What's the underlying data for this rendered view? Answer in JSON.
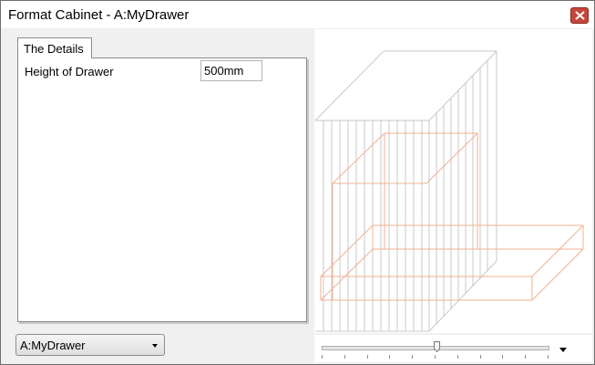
{
  "window": {
    "title": "Format Cabinet - A:MyDrawer"
  },
  "tabs": [
    {
      "label": "The Details"
    }
  ],
  "details": {
    "height_label": "Height of Drawer",
    "height_value": "500mm"
  },
  "object_selector": {
    "selected": "A:MyDrawer"
  },
  "zoom_slider": {
    "level": 0.51
  },
  "colors": {
    "cabinet_wireframe": "#c8c8c8",
    "drawer_wireframe": "#f0b090",
    "close_button": "#c7463b"
  },
  "icons": {
    "close": "close-icon",
    "dropdown": "chevron-down-icon",
    "view_menu": "triangle-down-icon"
  }
}
